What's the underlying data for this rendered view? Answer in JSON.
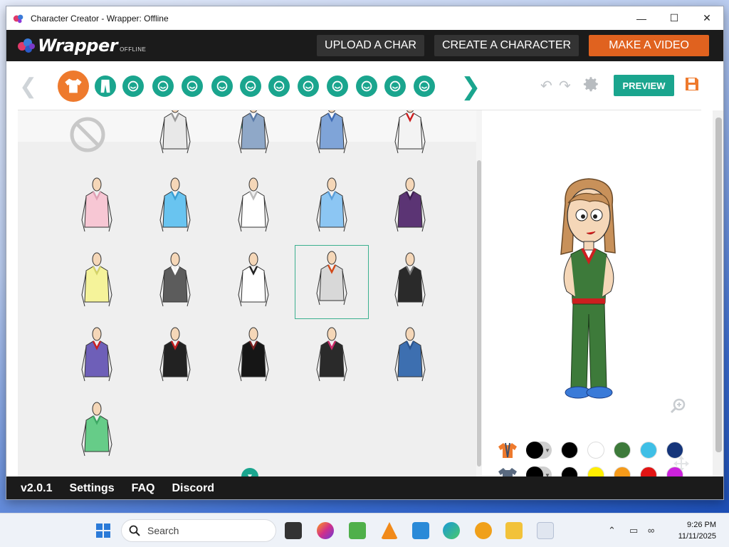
{
  "window": {
    "title": "Character Creator - Wrapper: Offline",
    "minimize_icon": "minimize-icon",
    "maximize_icon": "maximize-icon",
    "close_icon": "close-icon"
  },
  "appbar": {
    "logo_text": "Wrapper",
    "logo_sub": "OFFLINE",
    "buttons": [
      "UPLOAD A CHAR",
      "CREATE A CHARACTER",
      "MAKE A VIDEO"
    ]
  },
  "toolbar": {
    "categories": [
      {
        "name": "shirt",
        "icon": "shirt-icon",
        "active": true
      },
      {
        "name": "pants",
        "icon": "pants-icon",
        "active": false
      },
      {
        "name": "head",
        "icon": "head-icon",
        "active": false
      },
      {
        "name": "hair",
        "icon": "hair-icon",
        "active": false
      },
      {
        "name": "face",
        "icon": "face-shape-icon",
        "active": false
      },
      {
        "name": "mouth",
        "icon": "mouth-icon",
        "active": false
      },
      {
        "name": "ear",
        "icon": "ear-icon",
        "active": false
      },
      {
        "name": "eyebrows",
        "icon": "eyebrows-icon",
        "active": false
      },
      {
        "name": "eyes",
        "icon": "eyes-icon",
        "active": false
      },
      {
        "name": "facial",
        "icon": "mustache-icon",
        "active": false
      },
      {
        "name": "nose",
        "icon": "nose-icon",
        "active": false
      },
      {
        "name": "glasses",
        "icon": "glasses-icon",
        "active": false
      },
      {
        "name": "beard",
        "icon": "beard-icon",
        "active": false
      }
    ],
    "preview_label": "PREVIEW"
  },
  "wardrobe": {
    "items": [
      {
        "shirt": "#e8e8e8",
        "accent": "#999999"
      },
      {
        "shirt": "#8fa8c8",
        "accent": "#5a7aa8"
      },
      {
        "shirt": "#7fa4d8",
        "accent": "#3f6cb5"
      },
      {
        "shirt": "#f3f3f3",
        "accent": "#cc1f1f"
      },
      {
        "shirt": "#f7c7d4",
        "accent": "#e0a0b5"
      },
      {
        "shirt": "#69c4f0",
        "accent": "#3a9fd4"
      },
      {
        "shirt": "#ffffff",
        "accent": "#bbbbbb"
      },
      {
        "shirt": "#8cc6f3",
        "accent": "#5a9ed9"
      },
      {
        "shirt": "#5b3474",
        "accent": "#3d1f52"
      },
      {
        "shirt": "#f5f39a",
        "accent": "#d4d26a"
      },
      {
        "shirt": "#5c5c5c",
        "accent": "#ffffff"
      },
      {
        "shirt": "#ffffff",
        "accent": "#222222"
      },
      {
        "shirt": "#d8d8d8",
        "accent": "#d24a1a"
      },
      {
        "shirt": "#2a2a2a",
        "accent": "#777777"
      },
      {
        "shirt": "#6e5fb8",
        "accent": "#cc1f1f"
      },
      {
        "shirt": "#222222",
        "accent": "#c21f1f"
      },
      {
        "shirt": "#161616",
        "accent": "#7a1f1f"
      },
      {
        "shirt": "#2a2a2a",
        "accent": "#cc2a6a"
      },
      {
        "shirt": "#3d6fb0",
        "accent": "#2a5590"
      },
      {
        "shirt": "#66cc88",
        "accent": "#3da764"
      }
    ],
    "selected_index": 12
  },
  "swatches": {
    "row1": [
      "#000000",
      "#ffffff",
      "#3d7a3a",
      "#3fbfe6",
      "#15357a"
    ],
    "row2": [
      "#000000",
      "#ffee00",
      "#f59a1a",
      "#e21414",
      "#cc22dd"
    ]
  },
  "footer": {
    "links": [
      "v2.0.1",
      "Settings",
      "FAQ",
      "Discord"
    ]
  },
  "taskbar": {
    "search_placeholder": "Search",
    "time": "9:26 PM",
    "date": "11/11/2025"
  }
}
